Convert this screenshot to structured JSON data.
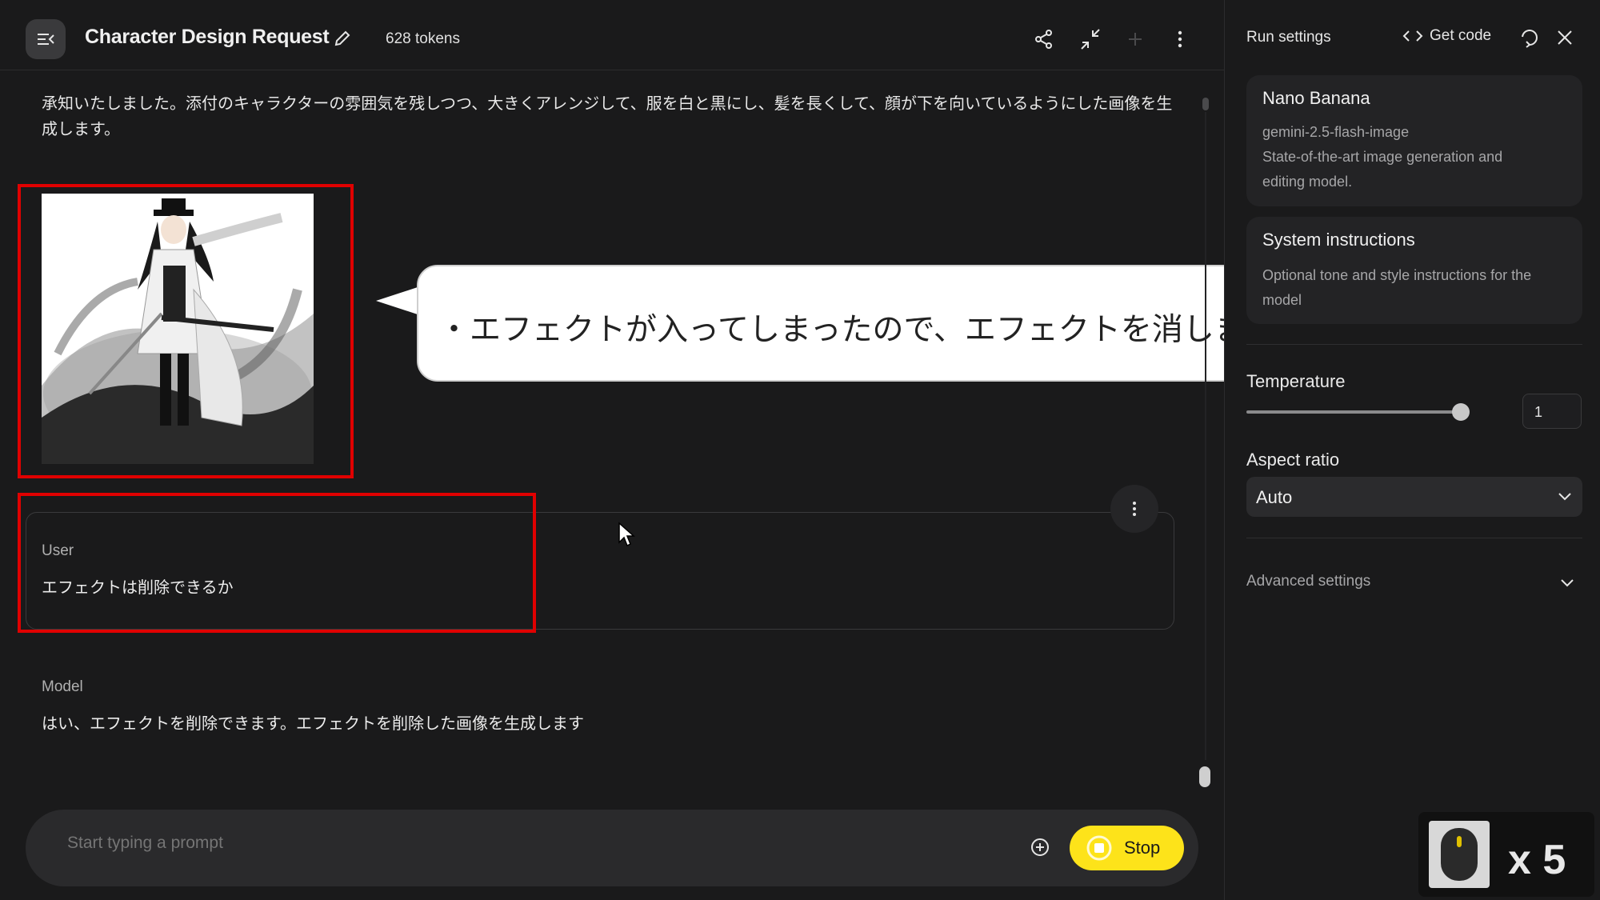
{
  "header": {
    "title": "Character Design Request",
    "tokens": "628 tokens"
  },
  "chat": {
    "model_reply_top": "承知いたしました。添付のキャラクターの雰囲気を残しつつ、大きくアレンジして、服を白と黒にし、髪を長くして、顔が下を向いているようにした画像を生成します。",
    "user_role": "User",
    "user_message": "エフェクトは削除できるか",
    "model_role": "Model",
    "model_message": "はい、エフェクトを削除できます。エフェクトを削除した画像を生成します"
  },
  "callout": {
    "text": "・エフェクトが入ってしまったので、エフェクトを消します"
  },
  "prompt": {
    "placeholder": "Start typing a prompt",
    "stop_label": "Stop"
  },
  "sidebar": {
    "title": "Run settings",
    "get_code": "Get code",
    "model_card": {
      "name": "Nano Banana",
      "id": "gemini-2.5-flash-image",
      "desc_line1": "State-of-the-art image generation and",
      "desc_line2": "editing model."
    },
    "system_card": {
      "title": "System instructions",
      "line1": "Optional tone and style instructions for the",
      "line2": "model"
    },
    "temperature": {
      "label": "Temperature",
      "value": "1",
      "fraction": 0.5
    },
    "aspect_ratio": {
      "label": "Aspect ratio",
      "value": "Auto"
    },
    "advanced": "Advanced settings"
  },
  "overlay": {
    "mouse_count": "x 5"
  },
  "colors": {
    "accent_yellow": "#fde31a",
    "highlight_red": "#e00000",
    "background": "#1a1a1b"
  }
}
